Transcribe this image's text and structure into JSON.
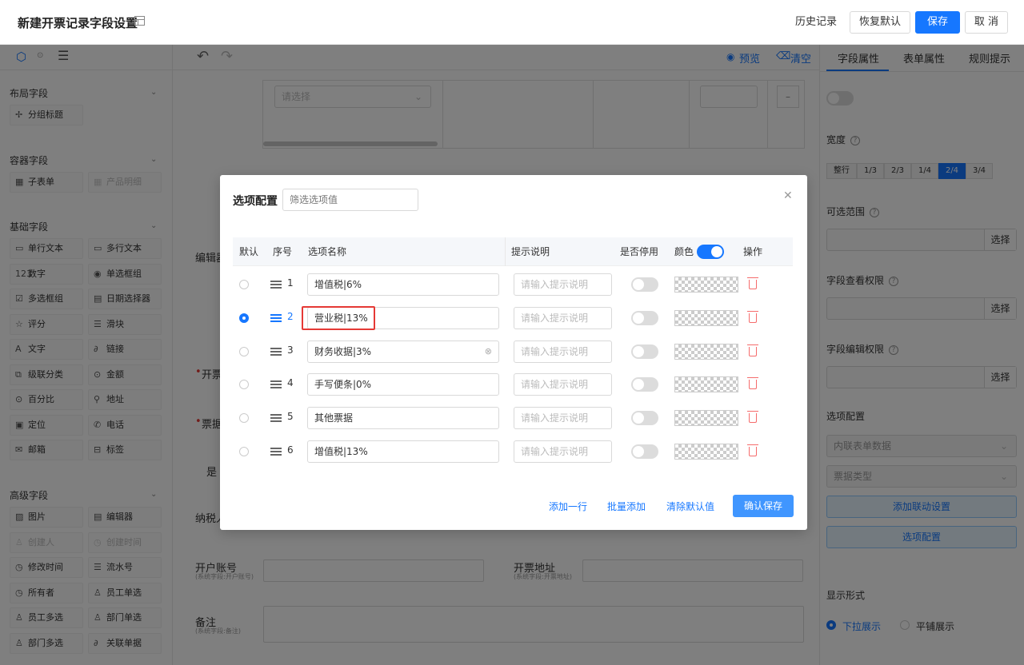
{
  "header": {
    "title": "新建开票记录字段设置",
    "history": "历史记录",
    "restore": "恢复默认",
    "save": "保存",
    "cancel": "取 消"
  },
  "left_panel": {
    "sections": [
      {
        "title": "布局字段",
        "items": [
          {
            "label": "分组标题",
            "icon": "✢"
          }
        ]
      },
      {
        "title": "容器字段",
        "items": [
          {
            "label": "子表单",
            "icon": "▦"
          },
          {
            "label": "产品明细",
            "icon": "▦",
            "disabled": true
          }
        ]
      },
      {
        "title": "基础字段",
        "items": [
          {
            "label": "单行文本",
            "icon": "▭"
          },
          {
            "label": "多行文本",
            "icon": "▭"
          },
          {
            "label": "数字",
            "icon": "123"
          },
          {
            "label": "单选框组",
            "icon": "◉"
          },
          {
            "label": "多选框组",
            "icon": "☑"
          },
          {
            "label": "日期选择器",
            "icon": "▤"
          },
          {
            "label": "评分",
            "icon": "☆"
          },
          {
            "label": "滑块",
            "icon": "☰"
          },
          {
            "label": "文字",
            "icon": "A"
          },
          {
            "label": "链接",
            "icon": "∂"
          },
          {
            "label": "级联分类",
            "icon": "⧉"
          },
          {
            "label": "金额",
            "icon": "⊙"
          },
          {
            "label": "百分比",
            "icon": "⊙"
          },
          {
            "label": "地址",
            "icon": "⚲"
          },
          {
            "label": "定位",
            "icon": "▣"
          },
          {
            "label": "电话",
            "icon": "✆"
          },
          {
            "label": "邮箱",
            "icon": "✉"
          },
          {
            "label": "标签",
            "icon": "⊟"
          }
        ]
      },
      {
        "title": "高级字段",
        "items": [
          {
            "label": "图片",
            "icon": "▨"
          },
          {
            "label": "编辑器",
            "icon": "▤"
          },
          {
            "label": "创建人",
            "icon": "♙",
            "disabled": true
          },
          {
            "label": "创建时间",
            "icon": "◷",
            "disabled": true
          },
          {
            "label": "修改时间",
            "icon": "◷"
          },
          {
            "label": "流水号",
            "icon": "☰"
          },
          {
            "label": "所有者",
            "icon": "◷"
          },
          {
            "label": "员工单选",
            "icon": "♙"
          },
          {
            "label": "员工多选",
            "icon": "♙"
          },
          {
            "label": "部门单选",
            "icon": "♙"
          },
          {
            "label": "部门多选",
            "icon": "♙"
          },
          {
            "label": "关联单据",
            "icon": "∂"
          }
        ]
      }
    ]
  },
  "center_panel": {
    "preview": "预览",
    "clear": "清空",
    "select_placeholder": "请选择",
    "field_editor": "编辑器",
    "rows": [
      {
        "label": "开户账号",
        "sub": "(系统字段:开户账号)"
      },
      {
        "label": "开票地址",
        "sub": "(系统字段:开票地址)"
      },
      {
        "label": "备注",
        "sub": "(系统字段:备注)"
      }
    ],
    "partial": {
      "a": "开票",
      "b": "票据",
      "c": "是",
      "d": "纳税人"
    }
  },
  "right_panel": {
    "tabs": [
      "字段属性",
      "表单属性",
      "规则提示"
    ],
    "width_label": "宽度",
    "width_options": [
      "整行",
      "1/3",
      "2/3",
      "1/4",
      "2/4",
      "3/4"
    ],
    "width_selected": "2/4",
    "range_label": "可选范围",
    "view_perm_label": "字段查看权限",
    "edit_perm_label": "字段编辑权限",
    "select_btn": "选择",
    "option_config_label": "选项配置",
    "source_value": "内联表单数据",
    "type_value": "票据类型",
    "add_link_btn": "添加联动设置",
    "option_config_btn": "选项配置",
    "display_label": "显示形式",
    "display_options": [
      "下拉展示",
      "平铺展示"
    ]
  },
  "modal": {
    "title": "选项配置",
    "filter_placeholder": "筛选选项值",
    "columns": {
      "default": "默认",
      "index": "序号",
      "name": "选项名称",
      "hint": "提示说明",
      "disabled": "是否停用",
      "color": "颜色",
      "action": "操作"
    },
    "hint_placeholder": "请输入提示说明",
    "rows": [
      {
        "index": "1",
        "name": "增值税|6%",
        "default": false
      },
      {
        "index": "2",
        "name": "营业税|13%",
        "default": true
      },
      {
        "index": "3",
        "name": "财务收据|3%",
        "default": false
      },
      {
        "index": "4",
        "name": "手写便条|0%",
        "default": false
      },
      {
        "index": "5",
        "name": "其他票据",
        "default": false
      },
      {
        "index": "6",
        "name": "增值税|13%",
        "default": false
      }
    ],
    "add_row": "添加一行",
    "batch_add": "批量添加",
    "clear_default": "清除默认值",
    "confirm": "确认保存",
    "highlight_color": "#e53935",
    "accent": "#1677ff"
  }
}
